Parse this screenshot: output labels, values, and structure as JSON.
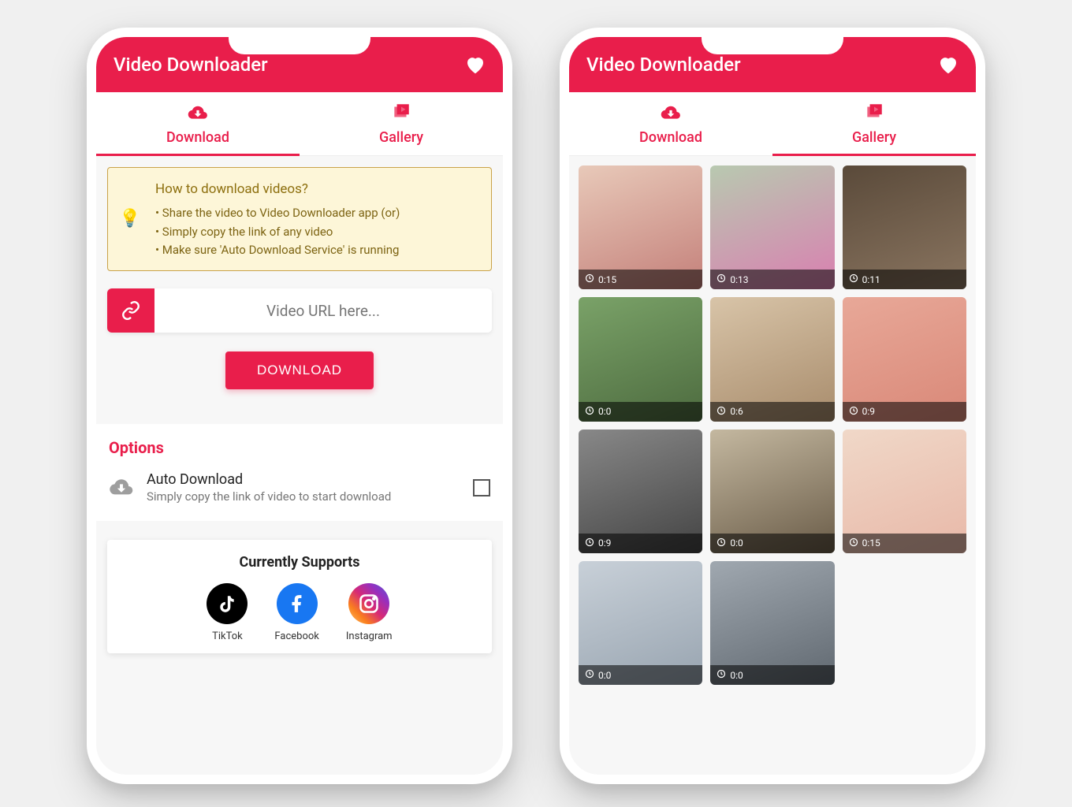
{
  "app": {
    "title": "Video Downloader"
  },
  "tabs": {
    "download": "Download",
    "gallery": "Gallery"
  },
  "info": {
    "title": "How to download videos?",
    "items": [
      "Share the video to Video Downloader app (or)",
      "Simply copy the link of any video",
      "Make sure 'Auto Download Service' is running"
    ]
  },
  "url": {
    "placeholder": "Video URL here..."
  },
  "download_button": "DOWNLOAD",
  "options": {
    "heading": "Options",
    "auto_download": {
      "title": "Auto Download",
      "subtitle": "Simply copy the link of video to start download"
    }
  },
  "supports": {
    "heading": "Currently Supports",
    "items": [
      "TikTok",
      "Facebook",
      "Instagram"
    ]
  },
  "gallery": {
    "videos": [
      {
        "duration": "0:15"
      },
      {
        "duration": "0:13"
      },
      {
        "duration": "0:11"
      },
      {
        "duration": "0:0"
      },
      {
        "duration": "0:6"
      },
      {
        "duration": "0:9"
      },
      {
        "duration": "0:9"
      },
      {
        "duration": "0:0"
      },
      {
        "duration": "0:15"
      },
      {
        "duration": "0:0"
      },
      {
        "duration": "0:0"
      }
    ]
  }
}
